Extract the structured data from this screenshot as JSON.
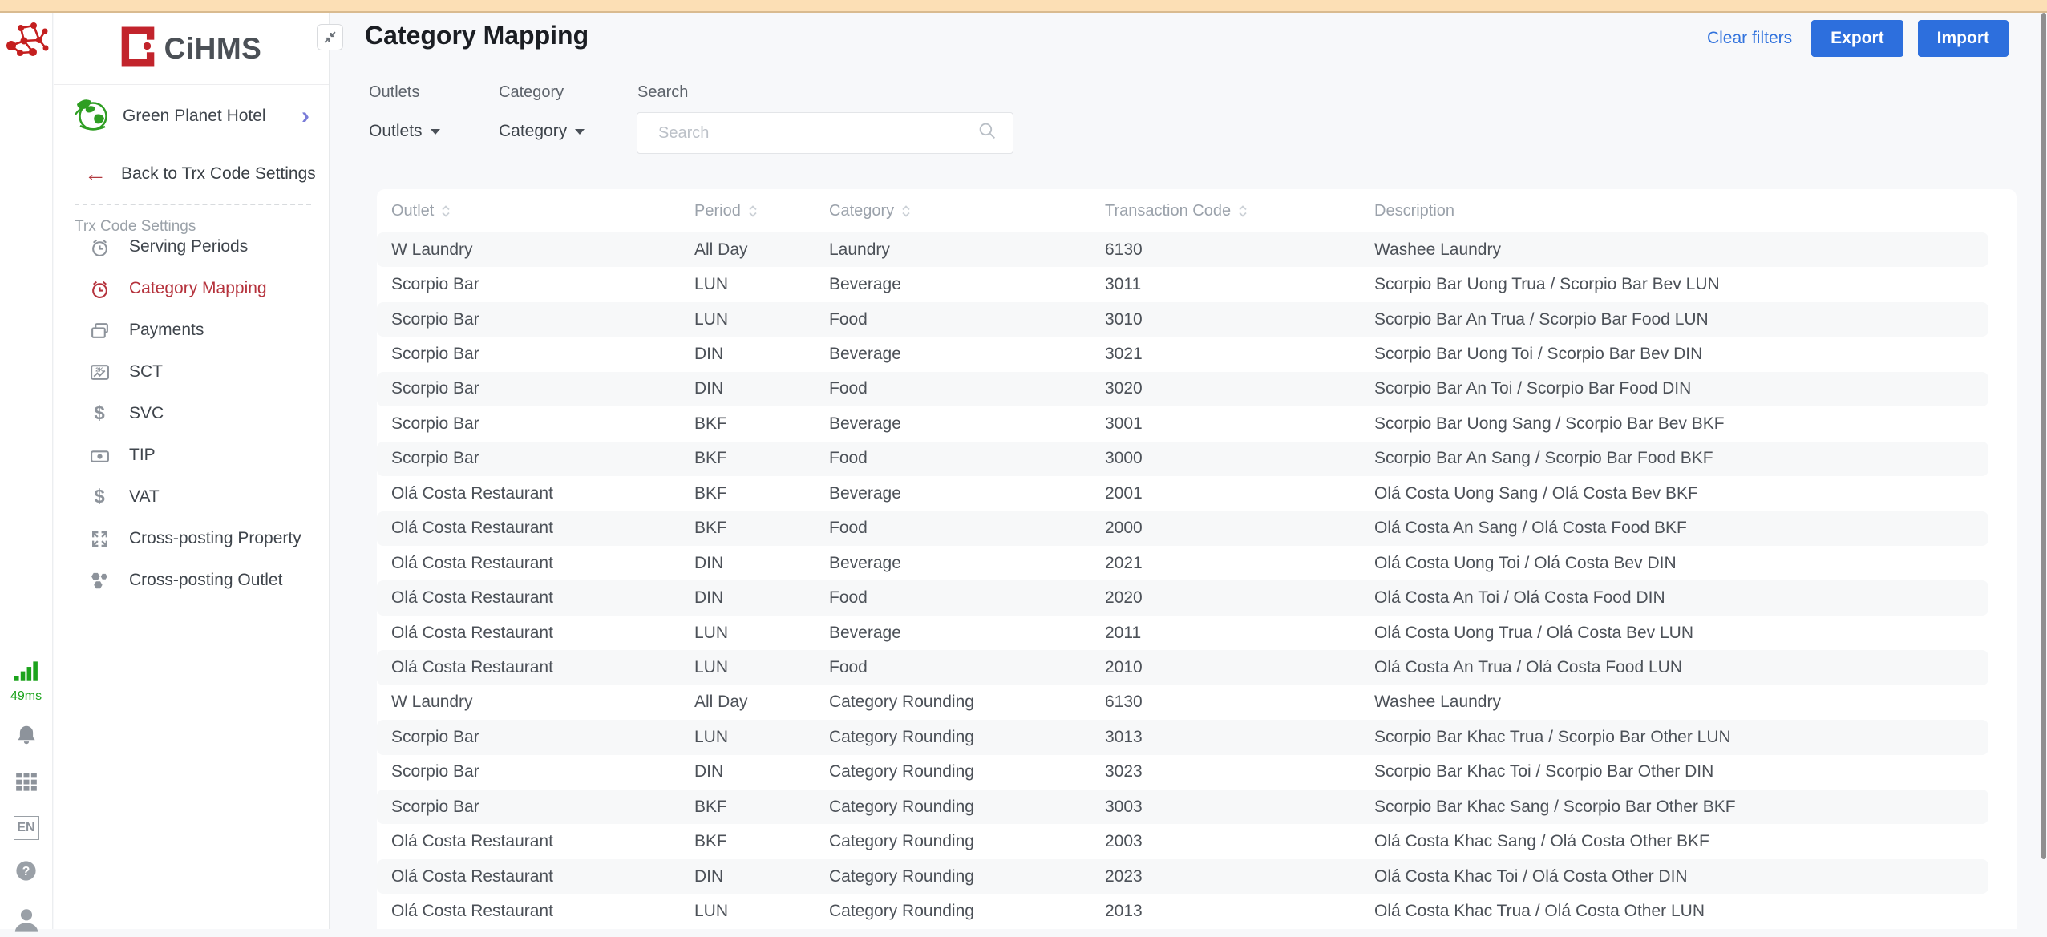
{
  "sidebar": {
    "logo_text": "CiHMS",
    "hotel_name": "Green Planet Hotel",
    "back_link": "Back to Trx Code Settings",
    "section_label": "Trx Code Settings",
    "items": [
      {
        "label": "Serving Periods",
        "active": false
      },
      {
        "label": "Category Mapping",
        "active": true
      },
      {
        "label": "Payments",
        "active": false
      },
      {
        "label": "SCT",
        "active": false
      },
      {
        "label": "SVC",
        "active": false
      },
      {
        "label": "TIP",
        "active": false
      },
      {
        "label": "VAT",
        "active": false
      },
      {
        "label": "Cross-posting Property",
        "active": false
      },
      {
        "label": "Cross-posting Outlet",
        "active": false
      }
    ]
  },
  "rail": {
    "latency": "49ms",
    "language": "EN"
  },
  "header": {
    "title": "Category Mapping",
    "clear_filters_label": "Clear filters",
    "export_label": "Export",
    "import_label": "Import"
  },
  "filters": {
    "outlets_label": "Outlets",
    "category_label": "Category",
    "search_label": "Search",
    "outlets_value": "Outlets",
    "category_value": "Category",
    "search_placeholder": "Search"
  },
  "table": {
    "columns": [
      "Outlet",
      "Period",
      "Category",
      "Transaction Code",
      "Description"
    ],
    "rows": [
      [
        "W Laundry",
        "All Day",
        "Laundry",
        "6130",
        "Washee Laundry"
      ],
      [
        "Scorpio Bar",
        "LUN",
        "Beverage",
        "3011",
        "Scorpio Bar Uong Trua / Scorpio Bar Bev LUN"
      ],
      [
        "Scorpio Bar",
        "LUN",
        "Food",
        "3010",
        "Scorpio Bar An Trua / Scorpio Bar Food LUN"
      ],
      [
        "Scorpio Bar",
        "DIN",
        "Beverage",
        "3021",
        "Scorpio Bar Uong Toi / Scorpio Bar Bev DIN"
      ],
      [
        "Scorpio Bar",
        "DIN",
        "Food",
        "3020",
        "Scorpio Bar An Toi / Scorpio Bar Food DIN"
      ],
      [
        "Scorpio Bar",
        "BKF",
        "Beverage",
        "3001",
        "Scorpio Bar Uong Sang / Scorpio Bar Bev BKF"
      ],
      [
        "Scorpio Bar",
        "BKF",
        "Food",
        "3000",
        "Scorpio Bar An Sang / Scorpio Bar Food BKF"
      ],
      [
        "Olá Costa Restaurant",
        "BKF",
        "Beverage",
        "2001",
        "Olá Costa Uong Sang / Olá Costa Bev BKF"
      ],
      [
        "Olá Costa Restaurant",
        "BKF",
        "Food",
        "2000",
        "Olá Costa An Sang / Olá Costa Food BKF"
      ],
      [
        "Olá Costa Restaurant",
        "DIN",
        "Beverage",
        "2021",
        "Olá Costa Uong Toi / Olá Costa Bev DIN"
      ],
      [
        "Olá Costa Restaurant",
        "DIN",
        "Food",
        "2020",
        "Olá Costa An Toi / Olá Costa Food DIN"
      ],
      [
        "Olá Costa Restaurant",
        "LUN",
        "Beverage",
        "2011",
        "Olá Costa Uong Trua / Olá Costa Bev LUN"
      ],
      [
        "Olá Costa Restaurant",
        "LUN",
        "Food",
        "2010",
        "Olá Costa An Trua / Olá Costa Food LUN"
      ],
      [
        "W Laundry",
        "All Day",
        "Category Rounding",
        "6130",
        "Washee Laundry"
      ],
      [
        "Scorpio Bar",
        "LUN",
        "Category Rounding",
        "3013",
        "Scorpio Bar Khac Trua / Scorpio Bar Other LUN"
      ],
      [
        "Scorpio Bar",
        "DIN",
        "Category Rounding",
        "3023",
        "Scorpio Bar Khac Toi / Scorpio Bar Other DIN"
      ],
      [
        "Scorpio Bar",
        "BKF",
        "Category Rounding",
        "3003",
        "Scorpio Bar Khac Sang / Scorpio Bar Other BKF"
      ],
      [
        "Olá Costa Restaurant",
        "BKF",
        "Category Rounding",
        "2003",
        "Olá Costa Khac Sang / Olá Costa Other BKF"
      ],
      [
        "Olá Costa Restaurant",
        "DIN",
        "Category Rounding",
        "2023",
        "Olá Costa Khac Toi / Olá Costa Other DIN"
      ],
      [
        "Olá Costa Restaurant",
        "LUN",
        "Category Rounding",
        "2013",
        "Olá Costa Khac Trua / Olá Costa Other LUN"
      ]
    ]
  },
  "colors": {
    "accent_blue": "#2d6fdd",
    "link_blue": "#3273dd",
    "active_red": "#b5323c",
    "brand_red": "#c2242c",
    "topbar_tan": "#fcdfb5",
    "stripe_gray": "#f7f8f9",
    "latency_green": "#1ba31b"
  }
}
